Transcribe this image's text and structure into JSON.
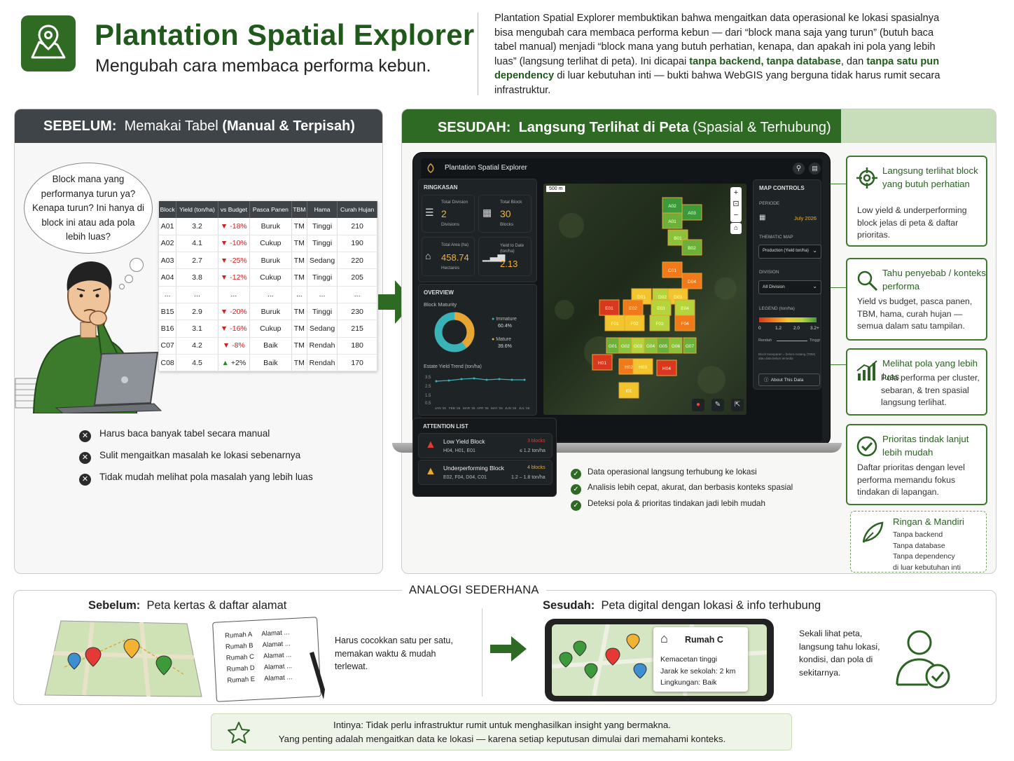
{
  "header": {
    "title": "Plantation Spatial Explorer",
    "subtitle": "Mengubah cara membaca performa kebun.",
    "intro_1": "Plantation Spatial Explorer membuktikan bahwa mengaitkan data operasional ke lokasi spasialnya bisa mengubah cara membaca performa kebun — dari “block mana saja yang turun” (butuh baca tabel manual) menjadi “block mana yang butuh perhatian, kenapa, dan apakah ini pola yang lebih luas” (langsung terlihat di peta). Ini dicapai ",
    "intro_b1": "tanpa backend, tanpa database",
    "intro_2": ", dan ",
    "intro_b2": "tanpa satu pun dependency",
    "intro_3": " di luar kebutuhan inti — bukti bahwa WebGIS yang berguna tidak harus rumit secara infrastruktur."
  },
  "before": {
    "label": "SEBELUM:",
    "title_a": "Memakai Tabel ",
    "title_b": "(Manual & Terpisah)",
    "thought": "Block mana yang performanya turun ya? Kenapa turun? Ini hanya di block ini atau ada pola lebih luas?",
    "table": {
      "headers": [
        "Block",
        "Yield (ton/ha)",
        "vs Budget",
        "Pasca Panen",
        "TBM",
        "Hama",
        "Curah Hujan"
      ],
      "rows": [
        [
          "A01",
          "3.2",
          "▼ -18%",
          "Buruk",
          "TM",
          "Tinggi",
          "210"
        ],
        [
          "A02",
          "4.1",
          "▼ -10%",
          "Cukup",
          "TM",
          "Tinggi",
          "190"
        ],
        [
          "A03",
          "2.7",
          "▼ -25%",
          "Buruk",
          "TM",
          "Sedang",
          "220"
        ],
        [
          "A04",
          "3.8",
          "▼ -12%",
          "Cukup",
          "TM",
          "Tinggi",
          "205"
        ],
        [
          "...",
          "...",
          "...",
          "...",
          "...",
          "...",
          "..."
        ],
        [
          "B15",
          "2.9",
          "▼ -20%",
          "Buruk",
          "TM",
          "Tinggi",
          "230"
        ],
        [
          "B16",
          "3.1",
          "▼ -16%",
          "Cukup",
          "TM",
          "Sedang",
          "215"
        ],
        [
          "C07",
          "4.2",
          "▼ -8%",
          "Baik",
          "TM",
          "Rendah",
          "180"
        ],
        [
          "C08",
          "4.5",
          "▲ +2%",
          "Baik",
          "TM",
          "Rendah",
          "170"
        ]
      ]
    },
    "problems": [
      "Harus baca banyak tabel secara manual",
      "Sulit mengaitkan masalah ke lokasi sebenarnya",
      "Tidak mudah melihat pola masalah yang lebih luas"
    ]
  },
  "after": {
    "label": "SESUDAH:",
    "title_a": "Langsung Terlihat di Peta ",
    "title_b": "(Spasial & Terhubung)",
    "app": {
      "title": "Plantation Spatial Explorer",
      "ringkasan": "RINGKASAN",
      "total_division_label": "Total Division",
      "total_division_value": "2",
      "total_division_unit": "Divisions",
      "total_block_label": "Total Block",
      "total_block_value": "30",
      "total_block_unit": "Blocks",
      "total_area_label": "Total Area (ha)",
      "total_area_value": "458.74",
      "total_area_unit": "Hectares",
      "ytd_label": "Yield to Date (ton/ha)",
      "ytd_value": "2.13",
      "overview": "OVERVIEW",
      "maturity_label": "Block Maturity",
      "immature_label": "Immature",
      "immature_pct": "60.4%",
      "mature_label": "Mature",
      "mature_pct": "39.6%",
      "trend_label": "Estate Yield Trend (ton/ha)",
      "trend_y": [
        "3.5",
        "2.5",
        "1.5",
        "0.5"
      ],
      "trend_x": [
        "JAN '26",
        "FEB '26",
        "MAR '26",
        "APR '26",
        "MAY '26",
        "JUN '26",
        "JUL '26"
      ],
      "scale": "500 m",
      "map_controls": "MAP CONTROLS",
      "periode_label": "PERIODE",
      "periode_value": "July 2026",
      "thematic_label": "THEMATIC MAP",
      "thematic_value": "Production (Yield ton/ha)",
      "division_label": "DIVISION",
      "division_value": "All Division",
      "legend_label": "LEGEND (ton/ha)",
      "legend_ticks": [
        "0",
        "1.2",
        "2.0",
        "3.2+"
      ],
      "legend_low": "Rendah",
      "legend_high": "Tinggi",
      "legend_note": "Block transparan = belum matang (TBM) atau data belum tersedia",
      "about": "About This Data",
      "attention": "ATTENTION LIST",
      "att1_title": "Low Yield Block",
      "att1_count": "3 blocks",
      "att1_blocks": "H04, H01, E01",
      "att1_range": "≤ 1.2 ton/ha",
      "att2_title": "Underperforming Block",
      "att2_count": "4 blocks",
      "att2_blocks": "E02, F04, D04, C01",
      "att2_range": "1.2 – 1.8 ton/ha",
      "blocks": [
        "A02",
        "A03",
        "A01",
        "B01",
        "B02",
        "C01",
        "D01",
        "D02",
        "D03",
        "D04",
        "E01",
        "E02",
        "E03",
        "E04",
        "F01",
        "F02",
        "F03",
        "F04",
        "G01",
        "G02",
        "G03",
        "G04",
        "G05",
        "G06",
        "G07",
        "H01",
        "H02",
        "H03",
        "H04",
        "I01"
      ]
    },
    "checks": [
      "Data operasional langsung terhubung ke lokasi",
      "Analisis lebih cepat, akurat, dan berbasis konteks spasial",
      "Deteksi pola & prioritas tindakan jadi lebih mudah"
    ],
    "callouts": [
      {
        "title": "Langsung terlihat block yang butuh perhatian",
        "text": "Low yield & underperforming block jelas di peta & daftar prioritas."
      },
      {
        "title": "Tahu penyebab / konteks performa",
        "text": "Yield vs budget, pasca panen, TBM, hama, curah hujan — semua dalam satu tampilan."
      },
      {
        "title": "Melihat pola yang lebih luas",
        "text": "Pola performa per cluster, sebaran, & tren spasial langsung terlihat."
      },
      {
        "title": "Prioritas tindak lanjut lebih mudah",
        "text": "Daftar prioritas dengan level performa memandu fokus tindakan di lapangan."
      }
    ],
    "light": {
      "title": "Ringan & Mandiri",
      "items": [
        "Tanpa backend",
        "Tanpa database",
        "Tanpa dependency",
        "di luar kebutuhan inti"
      ]
    }
  },
  "analogy": {
    "label": "ANALOGI SEDERHANA",
    "before_label": "Sebelum:",
    "before_title": "Peta kertas & daftar alamat",
    "addresses": [
      [
        "Rumah A",
        "Alamat ..."
      ],
      [
        "Rumah B",
        "Alamat ..."
      ],
      [
        "Rumah C",
        "Alamat ..."
      ],
      [
        "Rumah D",
        "Alamat ..."
      ],
      [
        "Rumah E",
        "Alamat ..."
      ]
    ],
    "before_text": "Harus cocokkan satu per satu, memakan waktu & mudah terlewat.",
    "after_label": "Sesudah:",
    "after_title": "Peta digital dengan lokasi & info terhubung",
    "popup_title": "Rumah C",
    "popup_lines": [
      "Kemacetan tinggi",
      "Jarak ke sekolah: 2 km",
      "Lingkungan: Baik"
    ],
    "after_text": "Sekali lihat peta, langsung tahu lokasi, kondisi, dan pola di sekitarnya."
  },
  "conclusion": {
    "line1": "Intinya: Tidak perlu infrastruktur rumit untuk menghasilkan insight yang bermakna.",
    "line2": "Yang penting adalah mengaitkan data ke lokasi — karena setiap keputusan dimulai dari memahami konteks."
  },
  "colors": {
    "brand_green": "#2f6b23",
    "dark_header": "#3e4447",
    "down_red": "#d32020",
    "up_green": "#2c8a2c"
  }
}
